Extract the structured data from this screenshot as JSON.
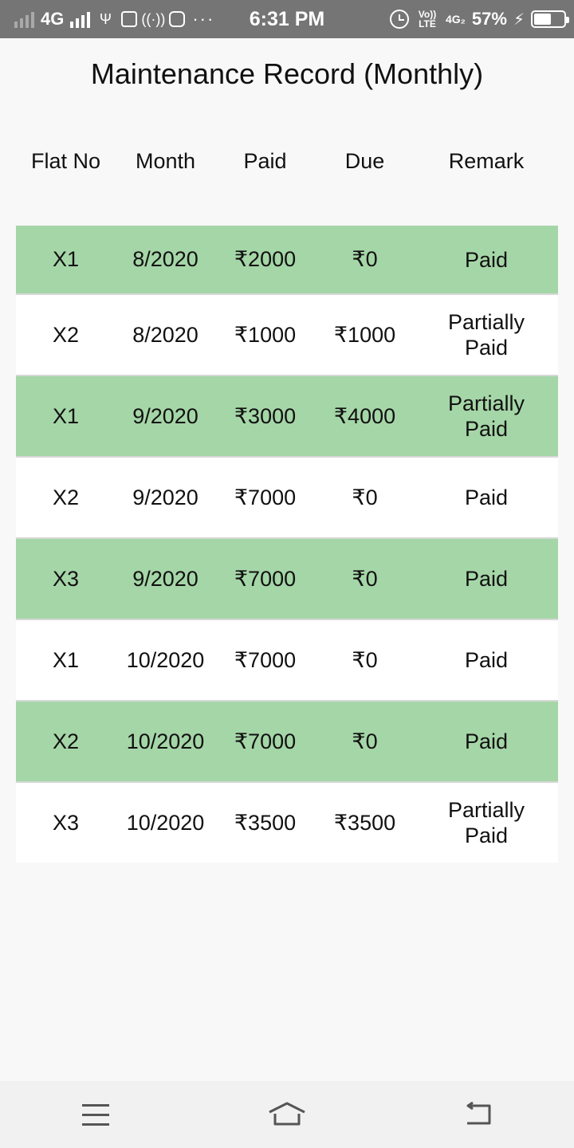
{
  "status_bar": {
    "network_left": "4G",
    "time": "6:31 PM",
    "volte": "Vo)) LTE",
    "network_right": "4G₂",
    "battery_percent": "57%",
    "battery_level": 0.57,
    "icons": [
      "signal-icon",
      "usb-icon",
      "usb-debug-icon",
      "hotspot-icon",
      "instagram-icon",
      "more-dots-icon",
      "alarm-icon",
      "charging-icon",
      "battery-icon"
    ]
  },
  "page": {
    "title": "Maintenance Record (Monthly)"
  },
  "table": {
    "headers": [
      "Flat No",
      "Month",
      "Paid",
      "Due",
      "Remark"
    ],
    "rows": [
      {
        "flat": "X1",
        "month": "8/2020",
        "paid": "₹2000",
        "due": "₹0",
        "remark": "Paid"
      },
      {
        "flat": "X2",
        "month": "8/2020",
        "paid": "₹1000",
        "due": "₹1000",
        "remark": "Partially Paid"
      },
      {
        "flat": "X1",
        "month": "9/2020",
        "paid": "₹3000",
        "due": "₹4000",
        "remark": "Partially Paid"
      },
      {
        "flat": "X2",
        "month": "9/2020",
        "paid": "₹7000",
        "due": "₹0",
        "remark": "Paid"
      },
      {
        "flat": "X3",
        "month": "9/2020",
        "paid": "₹7000",
        "due": "₹0",
        "remark": "Paid"
      },
      {
        "flat": "X1",
        "month": "10/2020",
        "paid": "₹7000",
        "due": "₹0",
        "remark": "Paid"
      },
      {
        "flat": "X2",
        "month": "10/2020",
        "paid": "₹7000",
        "due": "₹0",
        "remark": "Paid"
      },
      {
        "flat": "X3",
        "month": "10/2020",
        "paid": "₹3500",
        "due": "₹3500",
        "remark": "Partially Paid"
      }
    ]
  },
  "colors": {
    "row_highlight": "#a5d6a7",
    "row_plain": "#ffffff",
    "status_bar": "#757575"
  },
  "nav_bar": {
    "buttons": [
      "menu-icon",
      "home-icon",
      "back-icon"
    ]
  }
}
